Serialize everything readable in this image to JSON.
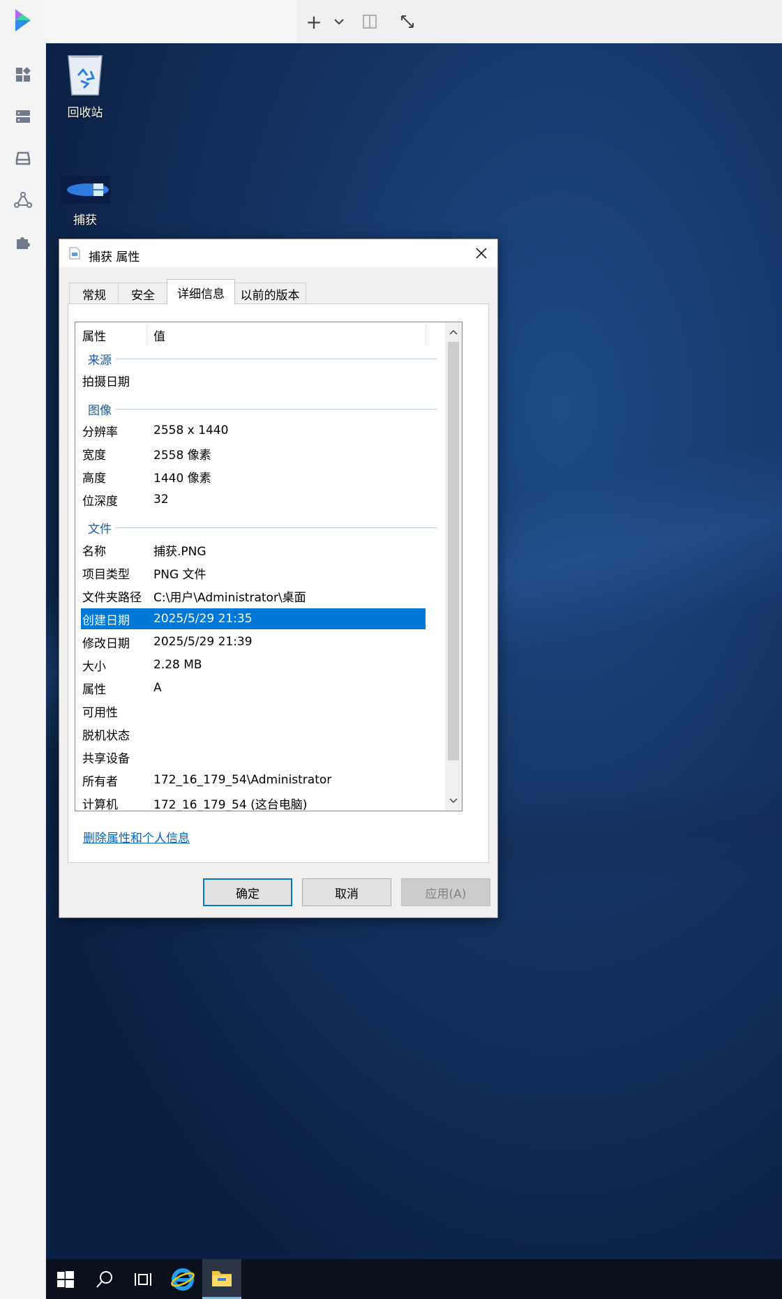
{
  "toolbar": {
    "add_label": "+"
  },
  "desktop": {
    "icons": [
      {
        "label": "回收站",
        "icon": "recycle-bin-icon"
      },
      {
        "label": "捕获",
        "icon": "image-file-icon"
      }
    ]
  },
  "dialog": {
    "title": "捕获 属性",
    "tabs": [
      {
        "label": "常规"
      },
      {
        "label": "安全"
      },
      {
        "label": "详细信息",
        "active": true
      },
      {
        "label": "以前的版本"
      }
    ],
    "columns": {
      "property": "属性",
      "value": "值"
    },
    "groups": {
      "source": "来源",
      "image": "图像",
      "file": "文件"
    },
    "rows": {
      "taken_date": {
        "k": "拍摄日期",
        "v": ""
      },
      "resolution": {
        "k": "分辨率",
        "v": "2558 x 1440"
      },
      "width": {
        "k": "宽度",
        "v": "2558 像素"
      },
      "height": {
        "k": "高度",
        "v": "1440 像素"
      },
      "bit_depth": {
        "k": "位深度",
        "v": "32"
      },
      "name": {
        "k": "名称",
        "v": "捕获.PNG"
      },
      "item_type": {
        "k": "项目类型",
        "v": "PNG 文件"
      },
      "folder_path": {
        "k": "文件夹路径",
        "v": "C:\\用户\\Administrator\\桌面"
      },
      "created": {
        "k": "创建日期",
        "v": "2025/5/29 21:35"
      },
      "modified": {
        "k": "修改日期",
        "v": "2025/5/29 21:39"
      },
      "size": {
        "k": "大小",
        "v": "2.28 MB"
      },
      "attributes": {
        "k": "属性",
        "v": "A"
      },
      "availability": {
        "k": "可用性",
        "v": ""
      },
      "offline": {
        "k": "脱机状态",
        "v": ""
      },
      "shared": {
        "k": "共享设备",
        "v": ""
      },
      "owner": {
        "k": "所有者",
        "v": "172_16_179_54\\Administrator"
      },
      "computer": {
        "k": "计算机",
        "v": "172_16_179_54 (这台电脑)"
      }
    },
    "remove_link": "删除属性和个人信息",
    "buttons": {
      "ok": "确定",
      "cancel": "取消",
      "apply": "应用(A)"
    }
  },
  "colors": {
    "selection": "#0078d7",
    "group_text": "#1e5aa8",
    "link": "#0066cc",
    "desktop_bg": "#143463"
  }
}
